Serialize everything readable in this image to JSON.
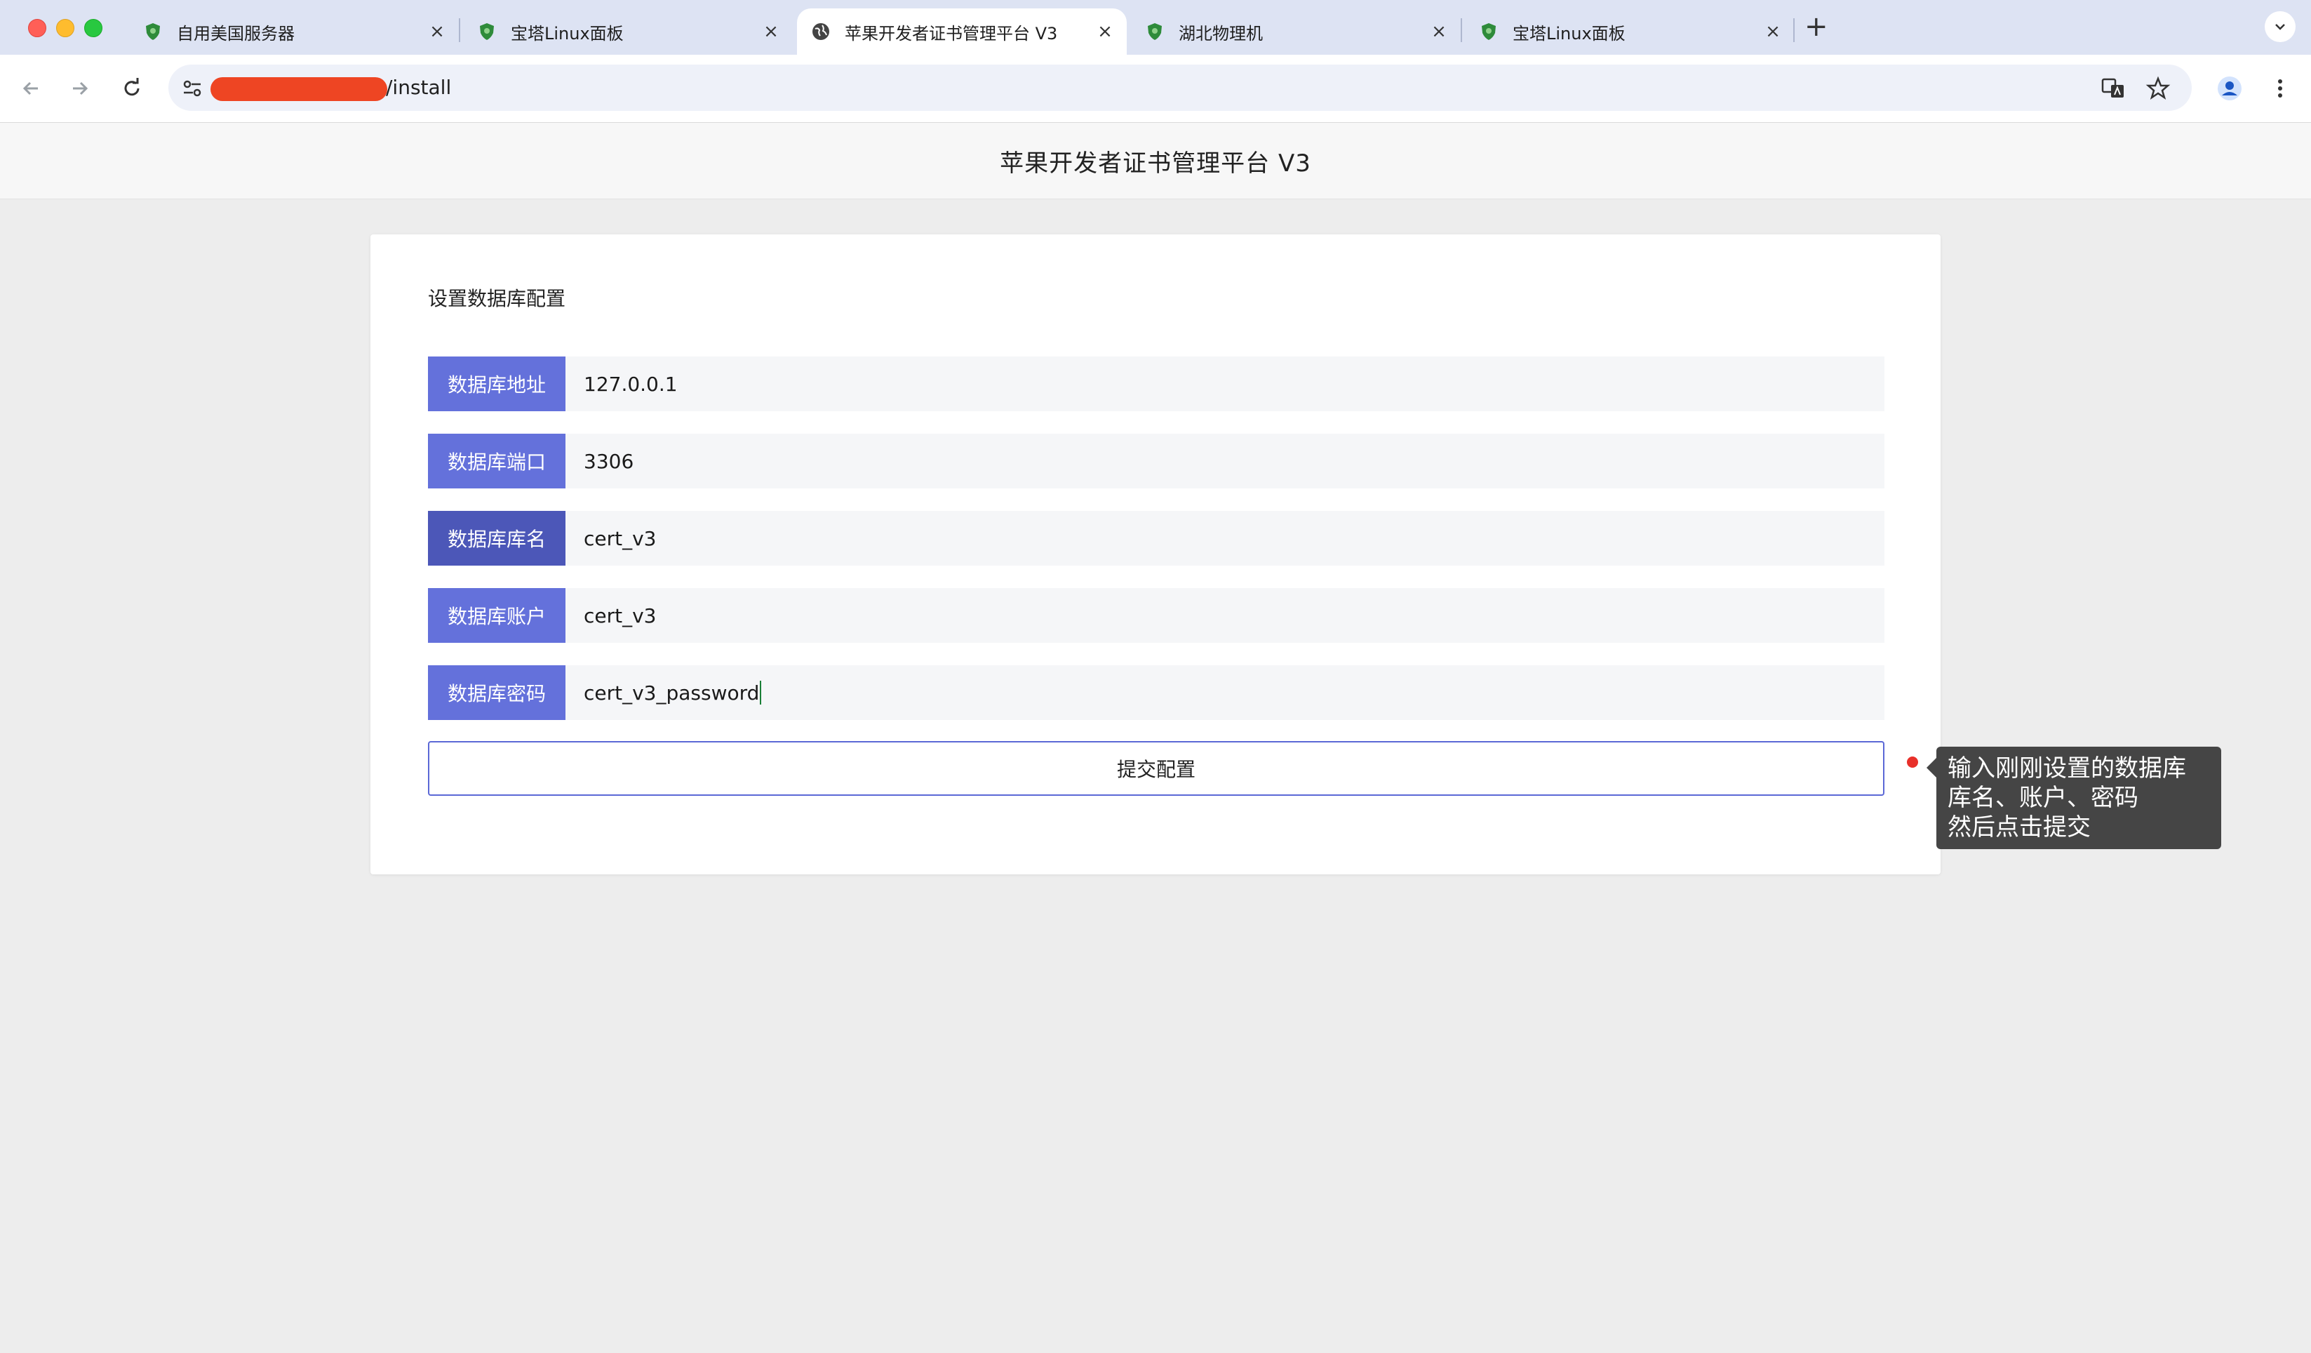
{
  "browser": {
    "tabs": [
      {
        "label": "自用美国服务器",
        "icon": "shield-favicon",
        "active": false
      },
      {
        "label": "宝塔Linux面板",
        "icon": "shield-favicon",
        "active": false
      },
      {
        "label": "苹果开发者证书管理平台 V3",
        "icon": "globe-favicon",
        "active": true
      },
      {
        "label": "湖北物理机",
        "icon": "shield-favicon",
        "active": false
      },
      {
        "label": "宝塔Linux面板",
        "icon": "shield-favicon",
        "active": false
      }
    ],
    "tab_close_glyph": "×",
    "new_tab_glyph": "+",
    "url_suffix": "/install"
  },
  "page": {
    "header_title": "苹果开发者证书管理平台 V3",
    "section_title": "设置数据库配置",
    "fields": [
      {
        "label": "数据库地址",
        "value": "127.0.0.1"
      },
      {
        "label": "数据库端口",
        "value": "3306"
      },
      {
        "label": "数据库库名",
        "value": "cert_v3"
      },
      {
        "label": "数据库账户",
        "value": "cert_v3"
      },
      {
        "label": "数据库密码",
        "value": "cert_v3_password"
      }
    ],
    "submit_label": "提交配置",
    "annotation": {
      "lines": [
        "输入刚刚设置的数据库",
        "库名、账户、密码",
        "然后点击提交"
      ]
    }
  },
  "colors": {
    "label_bg": "#6471db",
    "label_bg_active": "#4c57b8",
    "submit_border": "#5b68d6",
    "redaction": "#ee4523",
    "annotation_dot": "#e8302a"
  }
}
